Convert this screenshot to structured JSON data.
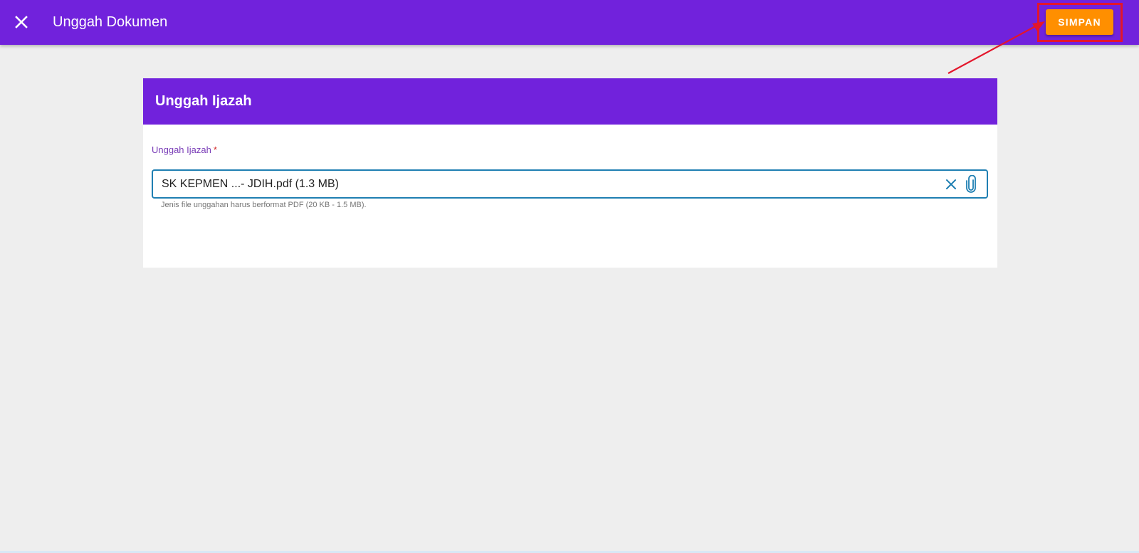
{
  "header": {
    "close_icon": "close-icon",
    "title": "Unggah Dokumen",
    "save_label": "SIMPAN"
  },
  "card": {
    "title": "Unggah Ijazah",
    "field": {
      "label": "Unggah Ijazah",
      "required_mark": "*",
      "value": "SK KEPMEN ...- JDIH.pdf (1.3 MB)",
      "clear_icon": "close-icon",
      "attach_icon": "paperclip-icon",
      "hint": "Jenis file unggahan harus berformat PDF (20 KB - 1.5 MB)."
    }
  },
  "colors": {
    "primary": "#7122dc",
    "accent": "#ff8f00",
    "field_border": "#1f7fb2",
    "annotation": "#e3162b"
  }
}
